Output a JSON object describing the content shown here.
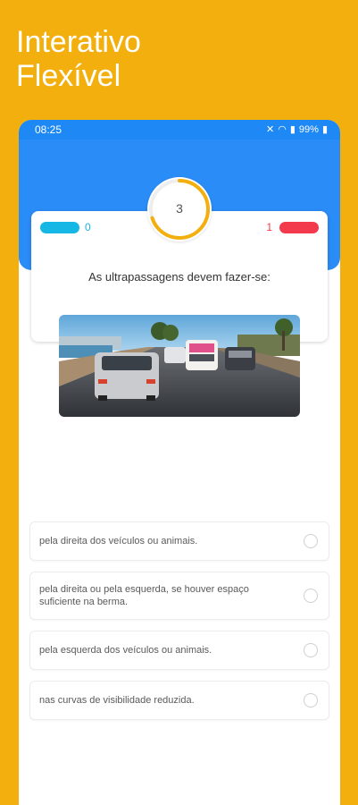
{
  "promo": {
    "line1": "Interativo",
    "line2": "Flexível"
  },
  "status": {
    "time": "08:25",
    "battery": "99%"
  },
  "quiz": {
    "score_left": "0",
    "score_right": "1",
    "timer_value": "3",
    "timer_progress": 0.7,
    "question": "As ultrapassagens devem fazer-se:",
    "answers": [
      {
        "text": "pela direita dos veículos ou animais."
      },
      {
        "text": "pela direita ou pela esquerda, se houver espaço suficiente na berma."
      },
      {
        "text": "pela esquerda dos veículos ou animais."
      },
      {
        "text": "nas curvas de visibilidade reduzida."
      }
    ]
  },
  "colors": {
    "background": "#F2AF0E",
    "header_blue": "#2A8CF6",
    "player_left": "#16B7E4",
    "player_right": "#F23A4C",
    "timer_ring": "#F2AF0E"
  }
}
